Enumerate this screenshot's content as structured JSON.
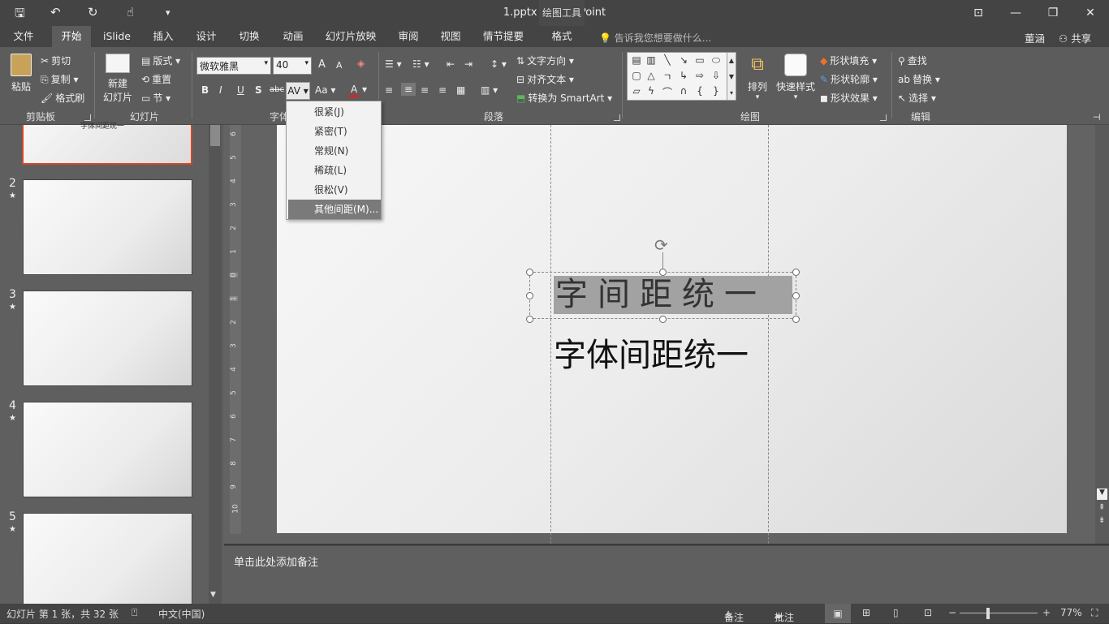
{
  "app": {
    "doc_title": "1.pptx - PowerPoint",
    "context_tab_group": "绘图工具"
  },
  "qat": {
    "save": "🖫",
    "undo": "↶",
    "redo": "↻",
    "touch": "☝",
    "customize": "▾"
  },
  "window": {
    "ribbon_display": "⊡",
    "minimize": "—",
    "restore": "❐",
    "close": "✕"
  },
  "tabs": [
    {
      "label": "文件"
    },
    {
      "label": "开始"
    },
    {
      "label": "iSlide"
    },
    {
      "label": "插入"
    },
    {
      "label": "设计"
    },
    {
      "label": "切换"
    },
    {
      "label": "动画"
    },
    {
      "label": "幻灯片放映"
    },
    {
      "label": "审阅"
    },
    {
      "label": "视图"
    },
    {
      "label": "情节提要"
    },
    {
      "label": "格式"
    }
  ],
  "tell_me": "告诉我您想要做什么...",
  "user": "董涵",
  "share": "共享",
  "ribbon": {
    "clipboard": {
      "paste": "粘贴",
      "cut": "剪切",
      "copy": "复制",
      "format_painter": "格式刷",
      "label": "剪贴板"
    },
    "slides": {
      "new_slide_line1": "新建",
      "new_slide_line2": "幻灯片",
      "layout": "版式",
      "reset": "重置",
      "section": "节",
      "label": "幻灯片"
    },
    "font": {
      "font_name": "微软雅黑",
      "font_size": "40",
      "grow": "A",
      "shrink": "A",
      "bold": "B",
      "italic": "I",
      "underline": "U",
      "shadow": "S",
      "strike": "abc",
      "spacing": "AV",
      "case": "Aa",
      "color": "A",
      "label": "字体"
    },
    "paragraph": {
      "text_direction": "文字方向",
      "align_text": "对齐文本",
      "smartart": "转换为 SmartArt",
      "label": "段落"
    },
    "drawing": {
      "arrange": "排列",
      "quick_styles": "快速样式",
      "shape_fill": "形状填充",
      "shape_outline": "形状轮廓",
      "shape_effects": "形状效果",
      "label": "绘图"
    },
    "editing": {
      "find": "查找",
      "replace": "替换",
      "select": "选择",
      "label": "编辑"
    }
  },
  "spacing_menu": [
    {
      "label": "很紧(J)"
    },
    {
      "label": "紧密(T)"
    },
    {
      "label": "常规(N)"
    },
    {
      "label": "稀疏(L)"
    },
    {
      "label": "很松(V)"
    },
    {
      "label": "其他间距(M)..."
    }
  ],
  "thumbnails": [
    {
      "num": "2",
      "star": "★"
    },
    {
      "num": "3",
      "star": "★"
    },
    {
      "num": "4",
      "star": "★"
    },
    {
      "num": "5",
      "star": "★"
    }
  ],
  "slide1_caption": "字体间距统一",
  "ruler_ticks": [
    "6",
    "5",
    "4",
    "3",
    "2",
    "1",
    "0",
    "1",
    "2",
    "3",
    "4",
    "5",
    "6",
    "7",
    "8",
    "9",
    "10"
  ],
  "slide": {
    "text_spaced": "字间距统一",
    "text_normal": "字体间距统一"
  },
  "notes_placeholder": "单击此处添加备注",
  "status": {
    "slide_info": "幻灯片 第 1 张，共 32 张",
    "language": "中文(中国)",
    "notes": "备注",
    "comments": "批注",
    "zoom": "77%"
  }
}
